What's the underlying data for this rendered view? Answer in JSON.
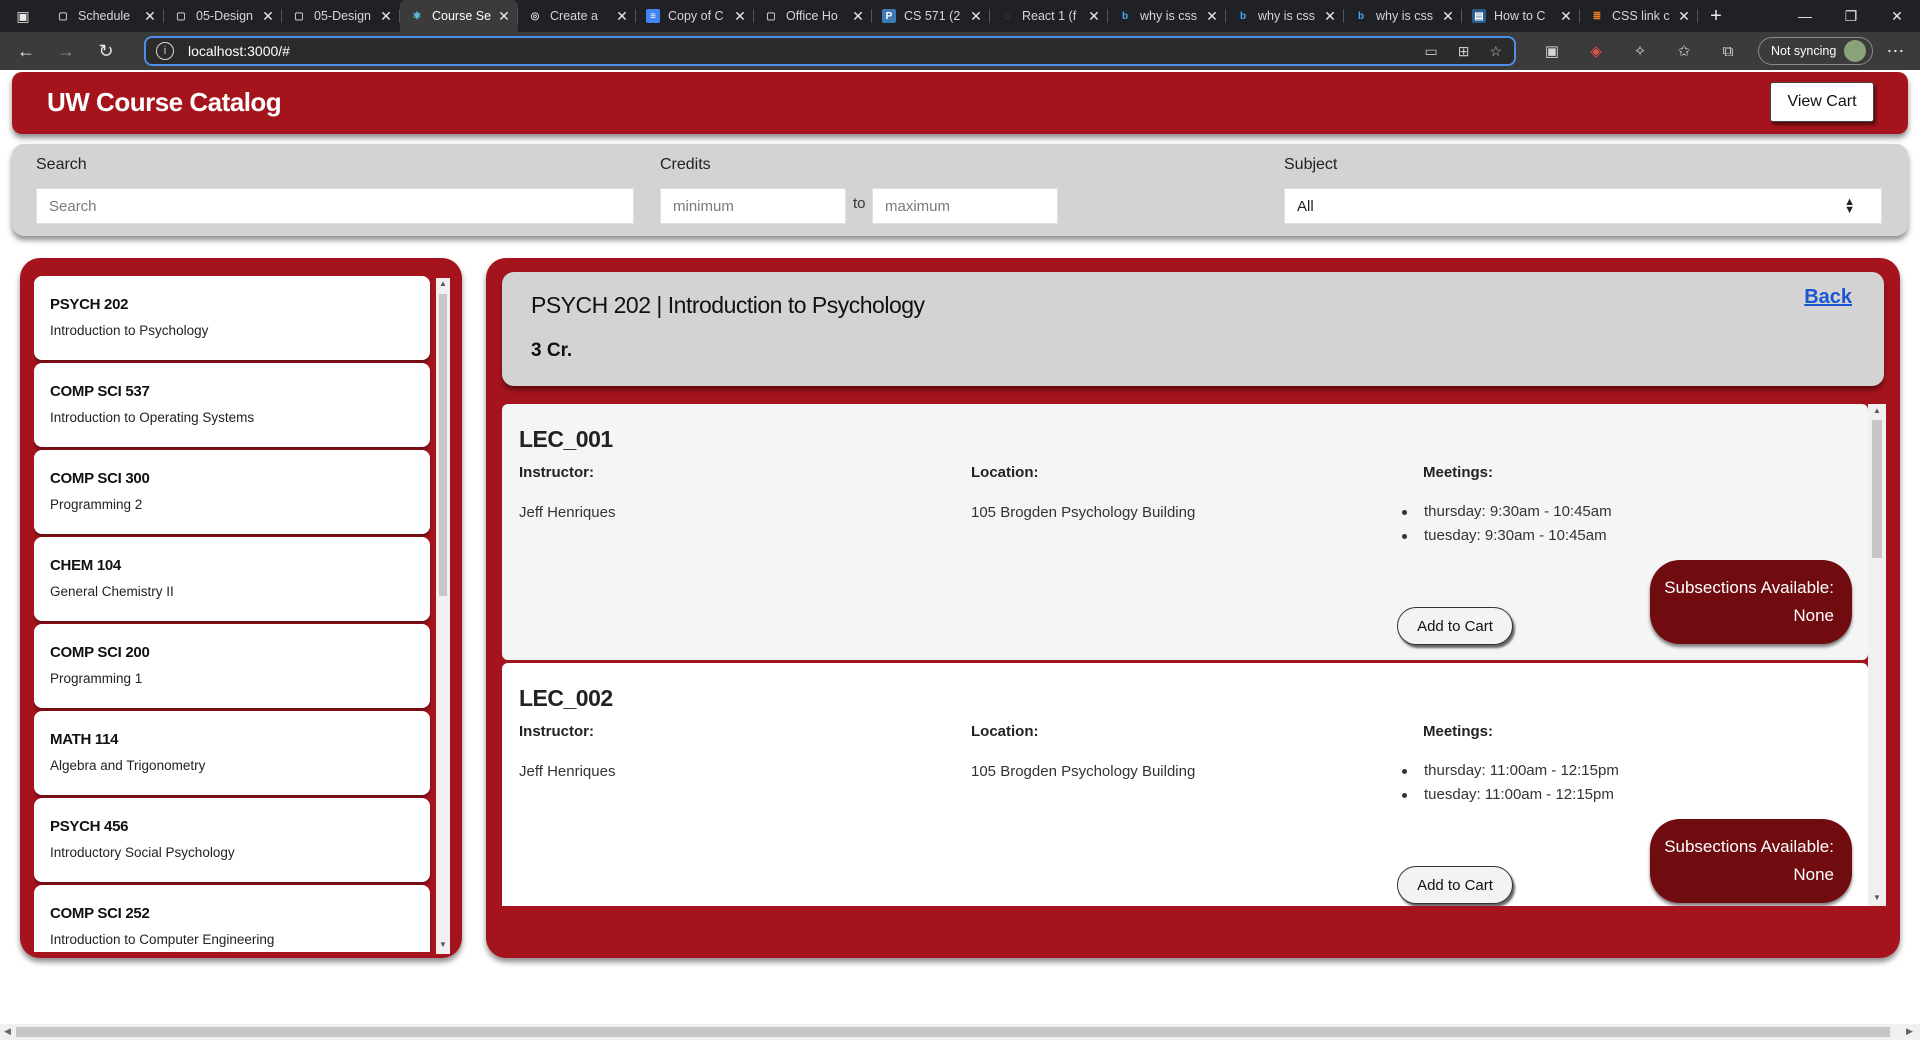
{
  "browser": {
    "tabs": [
      {
        "title": "Schedule",
        "favicon": "page",
        "active": false
      },
      {
        "title": "05-Design",
        "favicon": "page",
        "active": false
      },
      {
        "title": "05-Design",
        "favicon": "page",
        "active": false
      },
      {
        "title": "Course Se",
        "favicon": "react",
        "active": true
      },
      {
        "title": "Create a",
        "favicon": "chatgpt",
        "active": false
      },
      {
        "title": "Copy of C",
        "favicon": "docs",
        "active": false
      },
      {
        "title": "Office Ho",
        "favicon": "page",
        "active": false
      },
      {
        "title": "CS 571 (2",
        "favicon": "piazza",
        "active": false
      },
      {
        "title": "React 1 (f",
        "favicon": "react-red",
        "active": false
      },
      {
        "title": "why is css",
        "favicon": "bing",
        "active": false
      },
      {
        "title": "why is css",
        "favicon": "bing",
        "active": false
      },
      {
        "title": "why is css",
        "favicon": "bing",
        "active": false
      },
      {
        "title": "How to C",
        "favicon": "code",
        "active": false
      },
      {
        "title": "CSS link c",
        "favicon": "stackoverflow",
        "active": false
      }
    ],
    "url": "localhost:3000/#",
    "sync_label": "Not syncing"
  },
  "header": {
    "brand": "UW Course Catalog",
    "view_cart": "View Cart"
  },
  "filters": {
    "search_label": "Search",
    "search_placeholder": "Search",
    "credits_label": "Credits",
    "min_placeholder": "minimum",
    "to_text": "to",
    "max_placeholder": "maximum",
    "subject_label": "Subject",
    "subject_value": "All"
  },
  "courses": [
    {
      "code": "PSYCH 202",
      "name": "Introduction to Psychology"
    },
    {
      "code": "COMP SCI 537",
      "name": "Introduction to Operating Systems"
    },
    {
      "code": "COMP SCI 300",
      "name": "Programming 2"
    },
    {
      "code": "CHEM 104",
      "name": "General Chemistry II"
    },
    {
      "code": "COMP SCI 200",
      "name": "Programming 1"
    },
    {
      "code": "MATH 114",
      "name": "Algebra and Trigonometry"
    },
    {
      "code": "PSYCH 456",
      "name": "Introductory Social Psychology"
    },
    {
      "code": "COMP SCI 252",
      "name": "Introduction to Computer Engineering"
    }
  ],
  "selected_course": {
    "title": "PSYCH 202 | Introduction to Psychology",
    "credits": "3 Cr.",
    "back": "Back"
  },
  "section_labels": {
    "instructor": "Instructor:",
    "location": "Location:",
    "meetings": "Meetings:",
    "add_to_cart": "Add to Cart",
    "subsections": "Subsections Available:"
  },
  "sections": [
    {
      "name": "LEC_001",
      "instructor": "Jeff Henriques",
      "location": "105 Brogden Psychology Building",
      "meetings": [
        "thursday: 9:30am - 10:45am",
        "tuesday: 9:30am - 10:45am"
      ],
      "subsections": "None"
    },
    {
      "name": "LEC_002",
      "instructor": "Jeff Henriques",
      "location": "105 Brogden Psychology Building",
      "meetings": [
        "thursday: 11:00am - 12:15pm",
        "tuesday: 11:00am - 12:15pm"
      ],
      "subsections": "None"
    }
  ],
  "colors": {
    "brand_red": "#a5141d",
    "dark_red": "#700c10",
    "panel_gray": "#d3d3d3",
    "link_blue": "#1a55d6"
  }
}
